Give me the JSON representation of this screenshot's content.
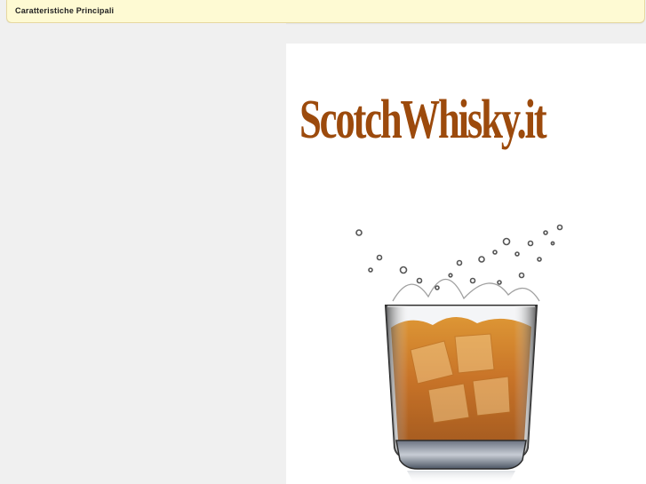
{
  "features_bar": {
    "title": "Caratteristiche Principali"
  },
  "ad": {
    "brand_name": "ScotchWhisky.it",
    "brand_color": "#9c4a0c",
    "image": "whisky-glass-splash"
  },
  "colors": {
    "page_background": "#f0f0f0",
    "bar_background": "#fefad3",
    "panel_background": "#ffffff"
  }
}
